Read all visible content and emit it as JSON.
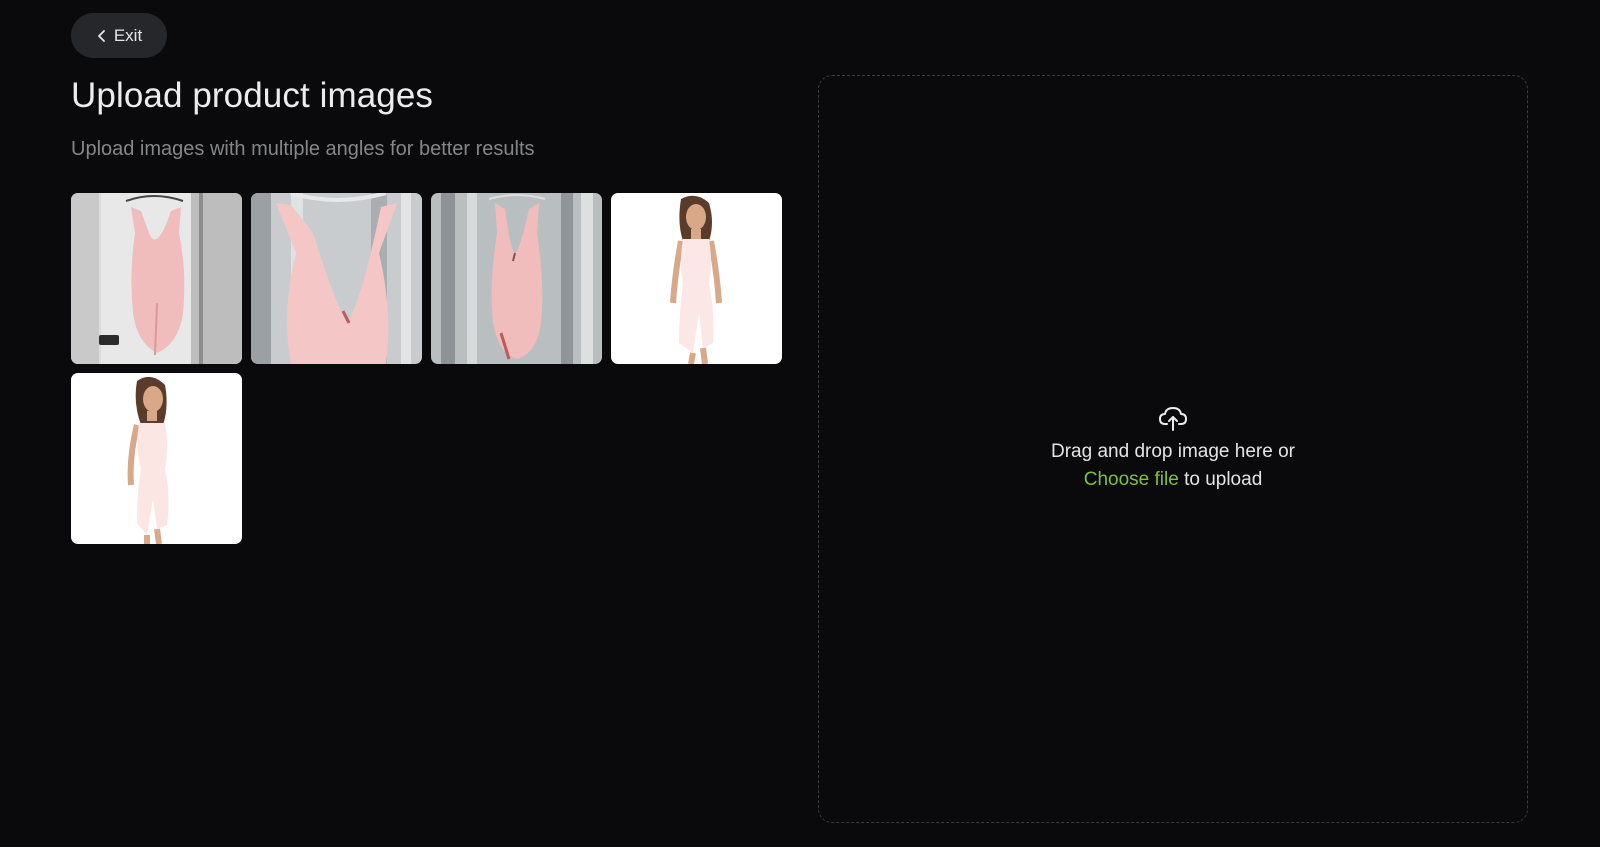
{
  "header": {
    "exit_label": "Exit"
  },
  "main": {
    "title": "Upload product images",
    "subtitle": "Upload images with multiple angles for better results"
  },
  "thumbnails": [
    {
      "name": "dress-on-door"
    },
    {
      "name": "dress-closeup"
    },
    {
      "name": "dress-on-wood"
    },
    {
      "name": "model-front"
    },
    {
      "name": "model-side"
    }
  ],
  "dropzone": {
    "line1": "Drag and drop image here or",
    "choose_label": "Choose file",
    "line2_suffix": " to upload",
    "icon": "cloud-upload-icon"
  },
  "colors": {
    "background": "#0a0a0c",
    "accent": "#7cc23a",
    "dress": "#f2c3c3"
  }
}
